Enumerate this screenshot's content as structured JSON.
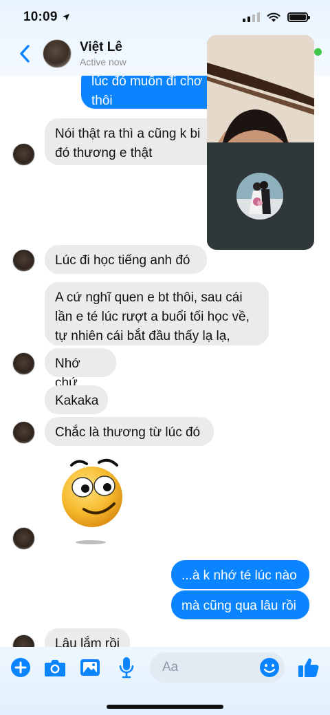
{
  "status_bar": {
    "time": "10:09"
  },
  "header": {
    "contact_name": "Việt Lê",
    "contact_status": "Active now"
  },
  "messages": {
    "m1": "lúc đó muốn đi chơ\nthôi",
    "m2": "Nói thật ra thì a cũng k bi\nđó thương e thật",
    "m3": "Lúc đi học tiếng anh đó",
    "m4": "A cứ nghĩ quen e bt thôi, sau cái\nlần e té lúc rượt a buổi tối học về,\ntự nhiên cái bắt đầu thấy lạ lạ,",
    "m5": "Nhớ chứ",
    "m6": "Kakaka",
    "m7": "Chắc là thương từ lúc đó",
    "m8": "...à k nhớ té lúc nào",
    "m9": "mà cũng qua lâu rồi",
    "m10": "Lâu lắm rồi"
  },
  "composer": {
    "placeholder": "Aa"
  },
  "icons": {
    "back": "chevron-left-icon",
    "plus": "plus-icon",
    "camera": "camera-icon",
    "gallery": "image-icon",
    "mic": "microphone-icon",
    "emoji": "smiley-icon",
    "like": "thumbs-up-icon"
  },
  "colors": {
    "accent": "#0a84ff",
    "incoming_bubble": "#ebebeb",
    "online": "#3fc84a"
  }
}
